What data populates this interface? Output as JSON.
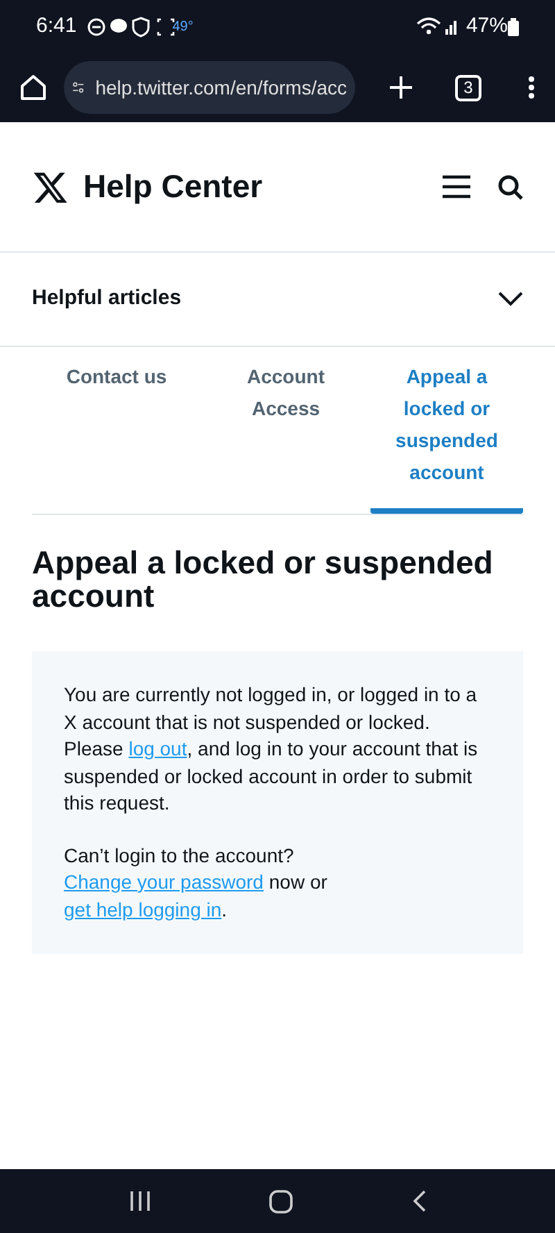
{
  "status_bar": {
    "time": "6:41",
    "temperature": "49°",
    "battery": "47%"
  },
  "browser": {
    "url": "help.twitter.com/en/forms/acc",
    "tab_count": "3"
  },
  "header": {
    "title": "Help Center"
  },
  "accordion": {
    "label": "Helpful articles",
    "expanded": false
  },
  "tabs": [
    {
      "label": "Contact us",
      "selected": false
    },
    {
      "label": "Account Access",
      "selected": false
    },
    {
      "label": "Appeal a locked or suspended account",
      "selected": true
    }
  ],
  "heading": "Appeal a locked or suspended account",
  "notice": [
    [
      {
        "kind": "text",
        "text": "You are currently not logged in, or logged in to a X account that is not suspended or locked. Please "
      },
      {
        "kind": "link",
        "text": "log out"
      },
      {
        "kind": "text",
        "text": ", and log in to your account that is suspended or locked account in order to submit this request."
      }
    ],
    [
      {
        "kind": "text",
        "text": "Can’t login to the account? "
      },
      {
        "kind": "link",
        "text": "Change your password"
      },
      {
        "kind": "text",
        "text": " now or "
      },
      {
        "kind": "link",
        "text": "get help logging in"
      },
      {
        "kind": "text",
        "text": "."
      }
    ]
  ]
}
